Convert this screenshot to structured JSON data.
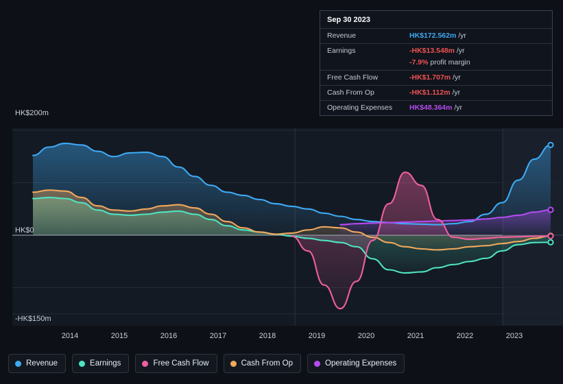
{
  "chart_data": {
    "type": "area",
    "title": "",
    "xlabel": "",
    "ylabel": "",
    "currency": "HK$",
    "ylim": [
      -150,
      200
    ],
    "y_ticks": [
      {
        "value": 200,
        "label": "HK$200m"
      },
      {
        "value": 0,
        "label": "HK$0"
      },
      {
        "value": -150,
        "label": "-HK$150m"
      }
    ],
    "x_ticks": [
      "2014",
      "2015",
      "2016",
      "2017",
      "2018",
      "2019",
      "2020",
      "2021",
      "2022",
      "2023"
    ],
    "grid": true,
    "legend_position": "bottom",
    "series": [
      {
        "name": "Revenue",
        "color": "#3eaaf5",
        "values": [
          152,
          168,
          175,
          172,
          160,
          150,
          157,
          158,
          150,
          130,
          112,
          95,
          82,
          76,
          68,
          60,
          55,
          50,
          42,
          36,
          30,
          26,
          24,
          22,
          21,
          20,
          22,
          26,
          40,
          62,
          105,
          145,
          172
        ]
      },
      {
        "name": "Earnings",
        "color": "#4fe3c1",
        "values": [
          70,
          72,
          70,
          62,
          48,
          40,
          38,
          40,
          44,
          46,
          40,
          30,
          18,
          10,
          6,
          2,
          -2,
          -6,
          -10,
          -14,
          -22,
          -45,
          -66,
          -72,
          -70,
          -62,
          -56,
          -50,
          -44,
          -30,
          -18,
          -14,
          -13.5
        ]
      },
      {
        "name": "Free Cash Flow",
        "color": "#ef5fa0",
        "values": [
          null,
          null,
          null,
          null,
          null,
          null,
          null,
          null,
          null,
          null,
          null,
          null,
          null,
          null,
          null,
          null,
          -2,
          -30,
          -95,
          -140,
          -88,
          -10,
          60,
          120,
          95,
          30,
          -4,
          -8,
          -6,
          -4,
          -3,
          -2,
          -1.7
        ]
      },
      {
        "name": "Cash From Op",
        "color": "#f0a85c",
        "values": [
          82,
          86,
          84,
          72,
          56,
          48,
          46,
          50,
          56,
          58,
          52,
          40,
          26,
          14,
          6,
          2,
          4,
          10,
          16,
          14,
          6,
          -4,
          -14,
          -22,
          -26,
          -28,
          -26,
          -22,
          -20,
          -16,
          -12,
          -6,
          -1.1
        ]
      },
      {
        "name": "Operating Expenses",
        "color": "#b44bf0",
        "values": [
          null,
          null,
          null,
          null,
          null,
          null,
          null,
          null,
          null,
          null,
          null,
          null,
          null,
          null,
          null,
          null,
          null,
          null,
          null,
          20,
          22,
          23,
          24,
          25,
          26,
          27,
          28,
          29,
          31,
          34,
          38,
          44,
          48.4
        ]
      }
    ]
  },
  "axis": {
    "y_top": "HK$200m",
    "y_zero": "HK$0",
    "y_bottom": "-HK$150m",
    "x_ticks": [
      "2014",
      "2015",
      "2016",
      "2017",
      "2018",
      "2019",
      "2020",
      "2021",
      "2022",
      "2023"
    ]
  },
  "tooltip": {
    "date": "Sep 30 2023",
    "rows": [
      {
        "label": "Revenue",
        "value": "HK$172.562m",
        "unit": "/yr",
        "color": "#3eaaf5"
      },
      {
        "label": "Earnings",
        "value": "-HK$13.548m",
        "unit": "/yr",
        "color": "#f05252"
      },
      {
        "label": "",
        "value": "-7.9%",
        "unit": "profit margin",
        "color": "#f05252"
      },
      {
        "label": "Free Cash Flow",
        "value": "-HK$1.707m",
        "unit": "/yr",
        "color": "#f05252"
      },
      {
        "label": "Cash From Op",
        "value": "-HK$1.112m",
        "unit": "/yr",
        "color": "#f05252"
      },
      {
        "label": "Operating Expenses",
        "value": "HK$48.364m",
        "unit": "/yr",
        "color": "#b44bf0"
      }
    ]
  },
  "legend": {
    "items": [
      {
        "label": "Revenue",
        "color": "#3eaaf5"
      },
      {
        "label": "Earnings",
        "color": "#4fe3c1"
      },
      {
        "label": "Free Cash Flow",
        "color": "#ef5fa0"
      },
      {
        "label": "Cash From Op",
        "color": "#f0a85c"
      },
      {
        "label": "Operating Expenses",
        "color": "#b44bf0"
      }
    ]
  }
}
